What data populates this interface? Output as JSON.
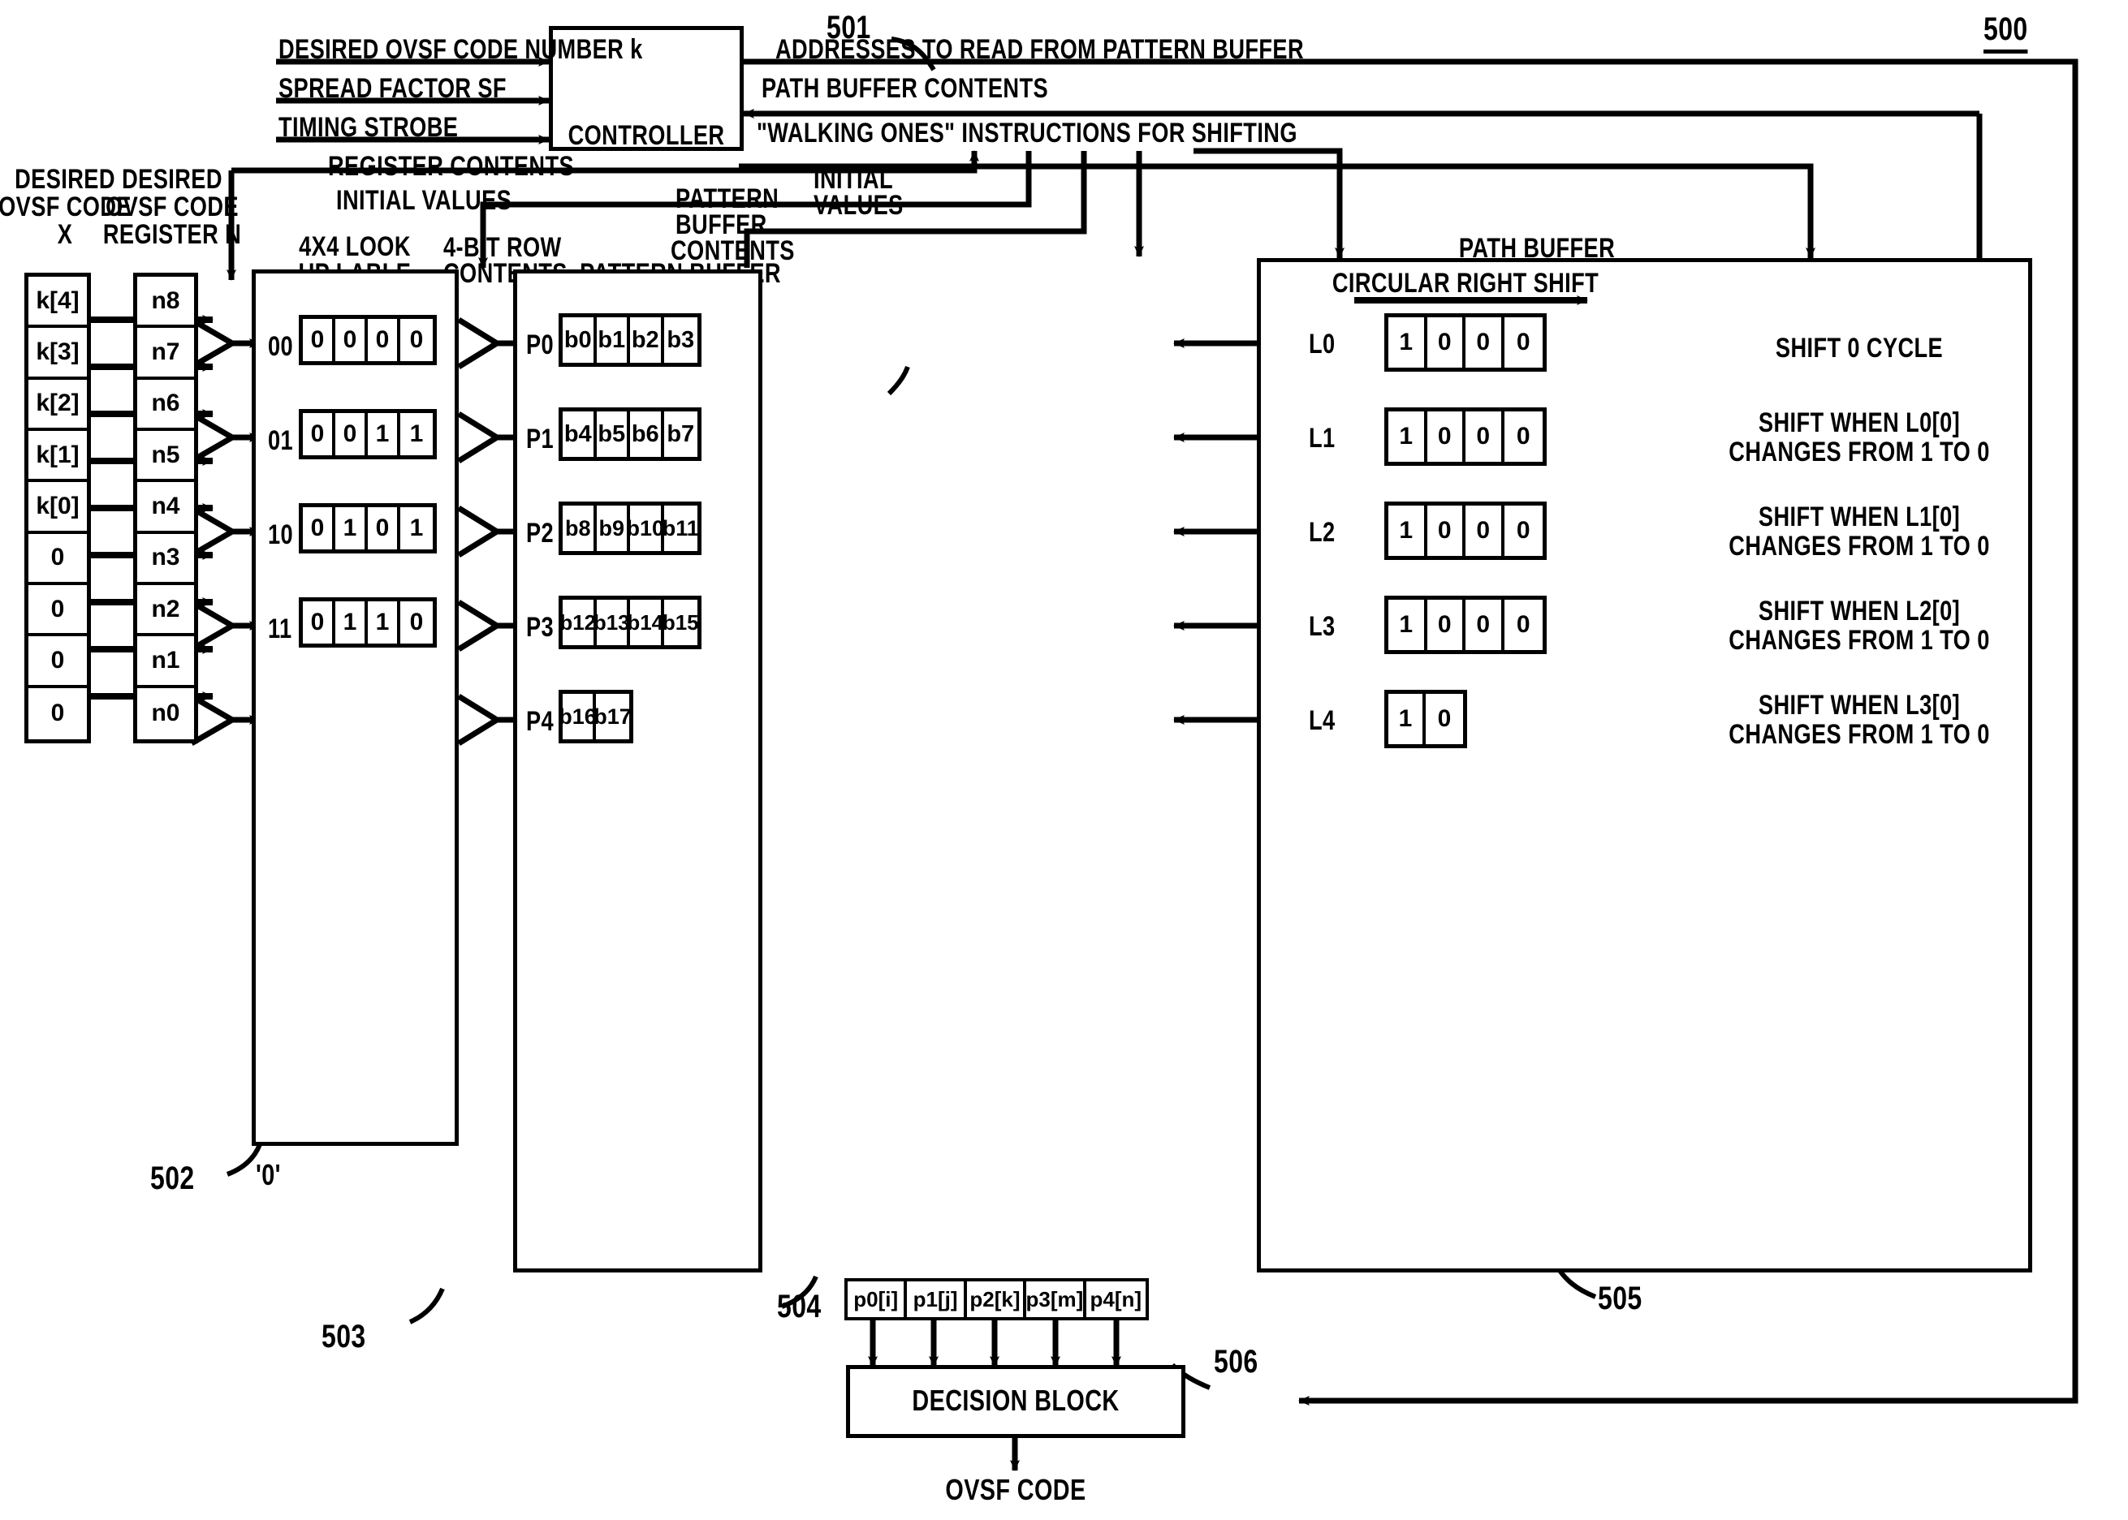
{
  "figure": {
    "number": "500"
  },
  "controller": {
    "ref": "501",
    "label": "CONTROLLER",
    "inputs_left": [
      "DESIRED OVSF CODE NUMBER k",
      "SPREAD FACTOR SF",
      "TIMING STROBE"
    ],
    "signals_right": [
      "ADDRESSES TO READ FROM PATTERN BUFFER",
      "PATH BUFFER CONTENTS",
      "\"WALKING ONES\" INSTRUCTIONS FOR SHIFTING"
    ],
    "signals_bottom_left": [
      "REGISTER CONTENTS",
      "INITIAL VALUES"
    ],
    "signals_bottom_mid": [
      "PATTERN",
      "BUFFER",
      "CONTENTS"
    ],
    "signals_bottom_right": [
      "INITIAL",
      "VALUES"
    ],
    "signal_4bit_row": [
      "4-BIT ROW",
      "CONTENTS"
    ]
  },
  "code_column": {
    "title": [
      "DESIRED",
      "OVSF CODE",
      "X"
    ],
    "cells": [
      "k[4]",
      "k[3]",
      "k[2]",
      "k[1]",
      "k[0]",
      "0",
      "0",
      "0",
      "0"
    ]
  },
  "register_column": {
    "ref": "502",
    "title": [
      "DESIRED",
      "OVSF CODE",
      "REGISTER N"
    ],
    "zero_label": "'0'",
    "cells": [
      "n8",
      "n7",
      "n6",
      "n5",
      "n4",
      "n3",
      "n2",
      "n1",
      "n0"
    ]
  },
  "lookup_table": {
    "ref": "503",
    "title": [
      "4X4 LOOK",
      "UP LABLE"
    ],
    "rows": [
      {
        "addr": "00",
        "bits": [
          "0",
          "0",
          "0",
          "0"
        ]
      },
      {
        "addr": "01",
        "bits": [
          "0",
          "0",
          "1",
          "1"
        ]
      },
      {
        "addr": "10",
        "bits": [
          "0",
          "1",
          "0",
          "1"
        ]
      },
      {
        "addr": "11",
        "bits": [
          "0",
          "1",
          "1",
          "0"
        ]
      }
    ]
  },
  "pattern_buffer": {
    "ref": "504",
    "title": "PATTERN BUFFER",
    "rows": [
      {
        "label": "P0",
        "bits": [
          "b0",
          "b1",
          "b2",
          "b3"
        ]
      },
      {
        "label": "P1",
        "bits": [
          "b4",
          "b5",
          "b6",
          "b7"
        ]
      },
      {
        "label": "P2",
        "bits": [
          "b8",
          "b9",
          "b10",
          "b11"
        ]
      },
      {
        "label": "P3",
        "bits": [
          "b12",
          "b13",
          "b14",
          "b15"
        ]
      },
      {
        "label": "P4",
        "bits": [
          "b16",
          "b17"
        ]
      }
    ],
    "outputs": [
      "p0[i]",
      "p1[j]",
      "p2[k]",
      "p3[m]",
      "p4[n]"
    ]
  },
  "path_buffer": {
    "ref": "505",
    "title": "PATH BUFFER",
    "shift_direction_label": "CIRCULAR RIGHT SHIFT",
    "rows": [
      {
        "label": "L0",
        "bits": [
          "1",
          "0",
          "0",
          "0"
        ],
        "note": [
          "SHIFT 0 CYCLE"
        ]
      },
      {
        "label": "L1",
        "bits": [
          "1",
          "0",
          "0",
          "0"
        ],
        "note": [
          "SHIFT WHEN L0[0]",
          "CHANGES FROM 1 TO 0"
        ]
      },
      {
        "label": "L2",
        "bits": [
          "1",
          "0",
          "0",
          "0"
        ],
        "note": [
          "SHIFT WHEN L1[0]",
          "CHANGES FROM 1 TO 0"
        ]
      },
      {
        "label": "L3",
        "bits": [
          "1",
          "0",
          "0",
          "0"
        ],
        "note": [
          "SHIFT WHEN L2[0]",
          "CHANGES FROM 1 TO 0"
        ]
      },
      {
        "label": "L4",
        "bits": [
          "1",
          "0"
        ],
        "note": [
          "SHIFT WHEN L3[0]",
          "CHANGES FROM 1 TO 0"
        ]
      }
    ]
  },
  "decision_block": {
    "ref": "506",
    "label": "DECISION BLOCK",
    "output_label": "OVSF CODE"
  }
}
